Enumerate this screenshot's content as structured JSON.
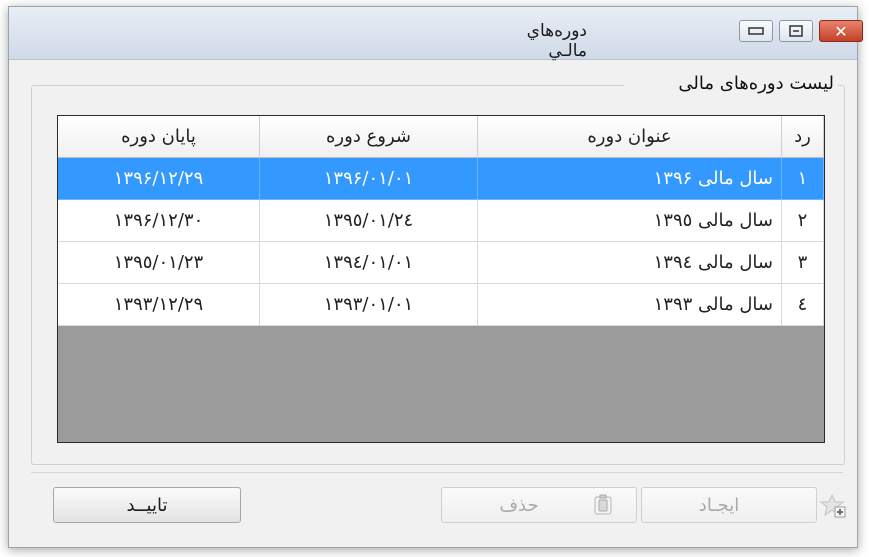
{
  "window": {
    "title": "دوره‌هاي مالـي",
    "close_symbol": "✕"
  },
  "group": {
    "title": "لیست دوره‌های مالی"
  },
  "table": {
    "headers": {
      "rd": "رد",
      "title": "عنوان دوره",
      "start": "شروع دوره",
      "end": "پایان دوره"
    },
    "rows": [
      {
        "rd": "١",
        "title": "سال مالی ١٣٩۶",
        "start": "١٣٩۶/٠١/٠١",
        "end": "١٣٩۶/١٢/٢٩",
        "selected": true
      },
      {
        "rd": "٢",
        "title": "سال مالی ١٣٩٥",
        "start": "١٣٩٥/٠١/٢٤",
        "end": "١٣٩۶/١٢/٣٠",
        "selected": false
      },
      {
        "rd": "٣",
        "title": "سال مالی ١٣٩٤",
        "start": "١٣٩٤/٠١/٠١",
        "end": "١٣٩٥/٠١/٢٣",
        "selected": false
      },
      {
        "rd": "٤",
        "title": "سال مالی ١٣٩٣",
        "start": "١٣٩٣/٠١/٠١",
        "end": "١٣٩٣/١٢/٢٩",
        "selected": false
      }
    ]
  },
  "buttons": {
    "confirm": "تاییــد",
    "delete": "حذف",
    "create": "ایجـاد"
  },
  "icons": {
    "close": "close-icon",
    "maximize": "maximize-icon",
    "minimize": "minimize-icon",
    "trash": "trash-icon",
    "add": "add-star-icon"
  },
  "colors": {
    "selection": "#3399ff",
    "close_button": "#c3412a",
    "grid_empty": "#9b9b9b"
  }
}
